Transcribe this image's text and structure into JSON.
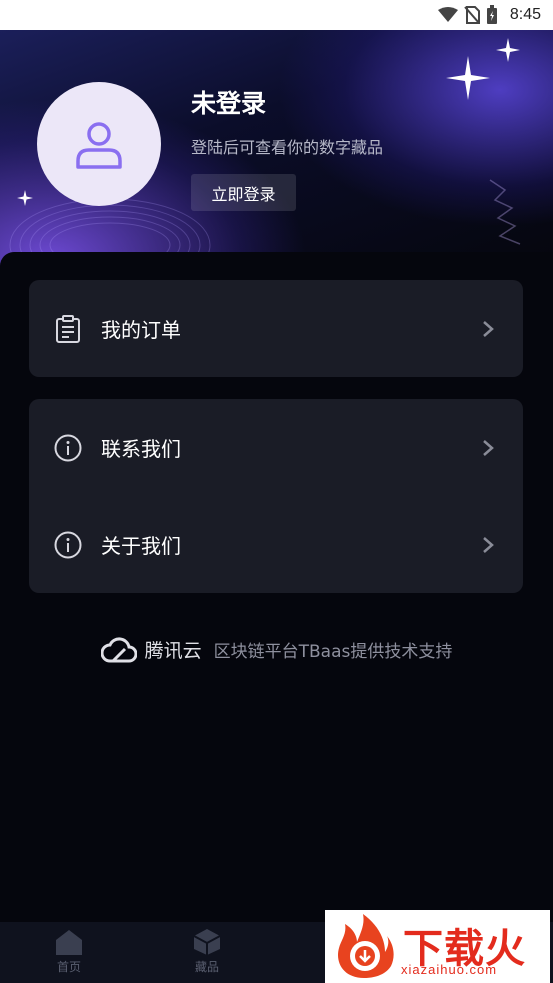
{
  "status_bar": {
    "time": "8:45"
  },
  "profile": {
    "title": "未登录",
    "subtitle": "登陆后可查看你的数字藏品",
    "login_button": "立即登录"
  },
  "menu": {
    "orders": "我的订单",
    "contact": "联系我们",
    "about": "关于我们"
  },
  "footer": {
    "brand": "腾讯云",
    "support": "区块链平台TBaas提供技术支持"
  },
  "bottom_nav": {
    "home": "首页",
    "collections": "藏品"
  },
  "watermark": {
    "text": "下载火",
    "url": "xiazaihuo.com"
  },
  "colors": {
    "accent": "#7b6ef0",
    "card": "#1a1c26",
    "background": "#05060d"
  }
}
